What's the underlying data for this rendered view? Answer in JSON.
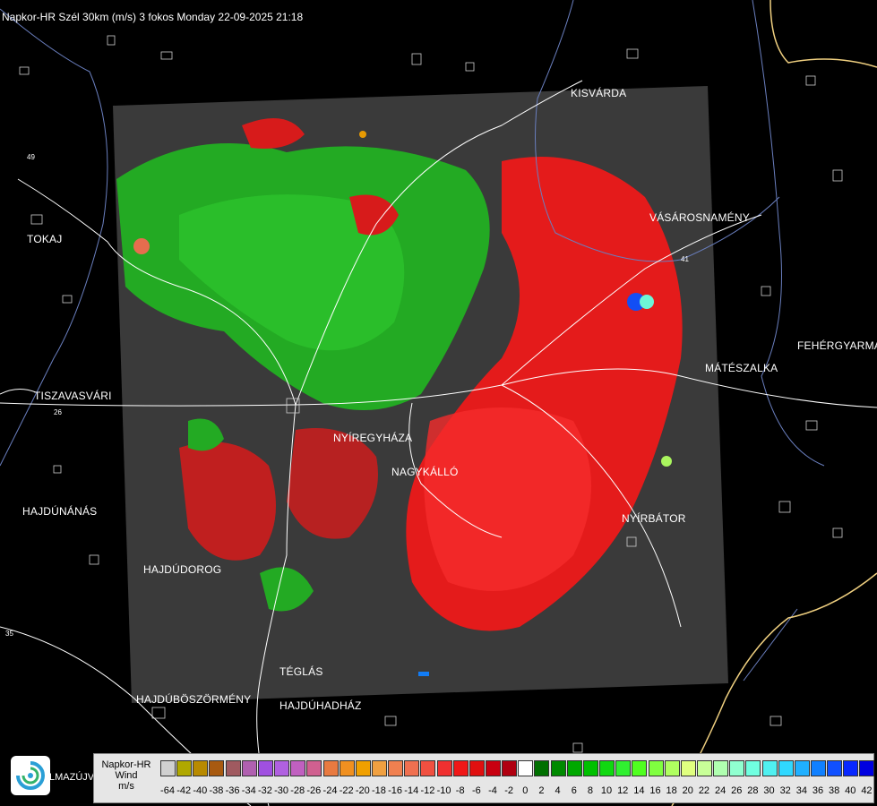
{
  "header": {
    "title": "Napkor-HR Szél 30km (m/s) 3 fokos Monday 22-09-2025 21:18"
  },
  "cities": [
    {
      "id": "kisvarda",
      "name": "KISVÁRDA"
    },
    {
      "id": "tokaj",
      "name": "TOKAJ"
    },
    {
      "id": "vasarosnameny",
      "name": "VÁSÁROSNAMÉNY"
    },
    {
      "id": "fehergyarmat",
      "name": "FEHÉRGYARMA"
    },
    {
      "id": "mateszalka",
      "name": "MÁTÉSZALKA"
    },
    {
      "id": "tiszavasvari",
      "name": "TISZAVASVÁRI"
    },
    {
      "id": "nyiregyhaza",
      "name": "NYÍREGYHÁZA"
    },
    {
      "id": "nagykallo",
      "name": "NAGYKÁLLÓ"
    },
    {
      "id": "hajdunanas",
      "name": "HAJDÚNÁNÁS"
    },
    {
      "id": "nyirbator",
      "name": "NYÍRBÁTOR"
    },
    {
      "id": "hajdudorog",
      "name": "HAJDÚDOROG"
    },
    {
      "id": "teglas",
      "name": "TÉGLÁS"
    },
    {
      "id": "hajduboszormeny",
      "name": "HAJDÚBÖSZÖRMÉNY"
    },
    {
      "id": "hajduhadhaz",
      "name": "HAJDÚHADHÁZ"
    },
    {
      "id": "hajdusamson",
      "name": "LMAZÚJVÁR"
    }
  ],
  "roads": [
    "26",
    "35",
    "41",
    "49"
  ],
  "legend": {
    "label_lines": [
      "Napkor-HR",
      "Wind",
      "m/s"
    ],
    "ticks": [
      "-64",
      "-42",
      "-40",
      "-38",
      "-36",
      "-34",
      "-32",
      "-30",
      "-28",
      "-26",
      "-24",
      "-22",
      "-20",
      "-18",
      "-16",
      "-14",
      "-12",
      "-10",
      "-8",
      "-6",
      "-4",
      "-2",
      "0",
      "2",
      "4",
      "6",
      "8",
      "10",
      "12",
      "14",
      "16",
      "18",
      "20",
      "22",
      "24",
      "26",
      "28",
      "30",
      "32",
      "34",
      "36",
      "38",
      "40",
      "42"
    ],
    "colors": [
      "#d0d0d0",
      "#b0a800",
      "#b88a00",
      "#a85a10",
      "#a05a60",
      "#b060b0",
      "#a050e0",
      "#b060e0",
      "#c060c0",
      "#d06090",
      "#e87a40",
      "#f09020",
      "#f0a000",
      "#f0a040",
      "#f08050",
      "#f07050",
      "#f05040",
      "#f03030",
      "#f01818",
      "#e01010",
      "#c80010",
      "#b00010",
      "#ffffff",
      "#007000",
      "#008a00",
      "#00a800",
      "#00c000",
      "#10d810",
      "#30f030",
      "#50ff20",
      "#80ff40",
      "#b0ff60",
      "#e0ff80",
      "#c8ff98",
      "#b0ffb0",
      "#90ffd0",
      "#70ffe0",
      "#50f0f0",
      "#30d8ff",
      "#20b0ff",
      "#1080ff",
      "#1050ff",
      "#0828ff",
      "#0000e0"
    ]
  },
  "colors": {
    "bg": "#000000",
    "radar_bg": "#3a3a3a",
    "outflow": "#ff1a1a",
    "inflow": "#22cc22",
    "river": "#6a7fbf",
    "border": "#f0d080"
  }
}
